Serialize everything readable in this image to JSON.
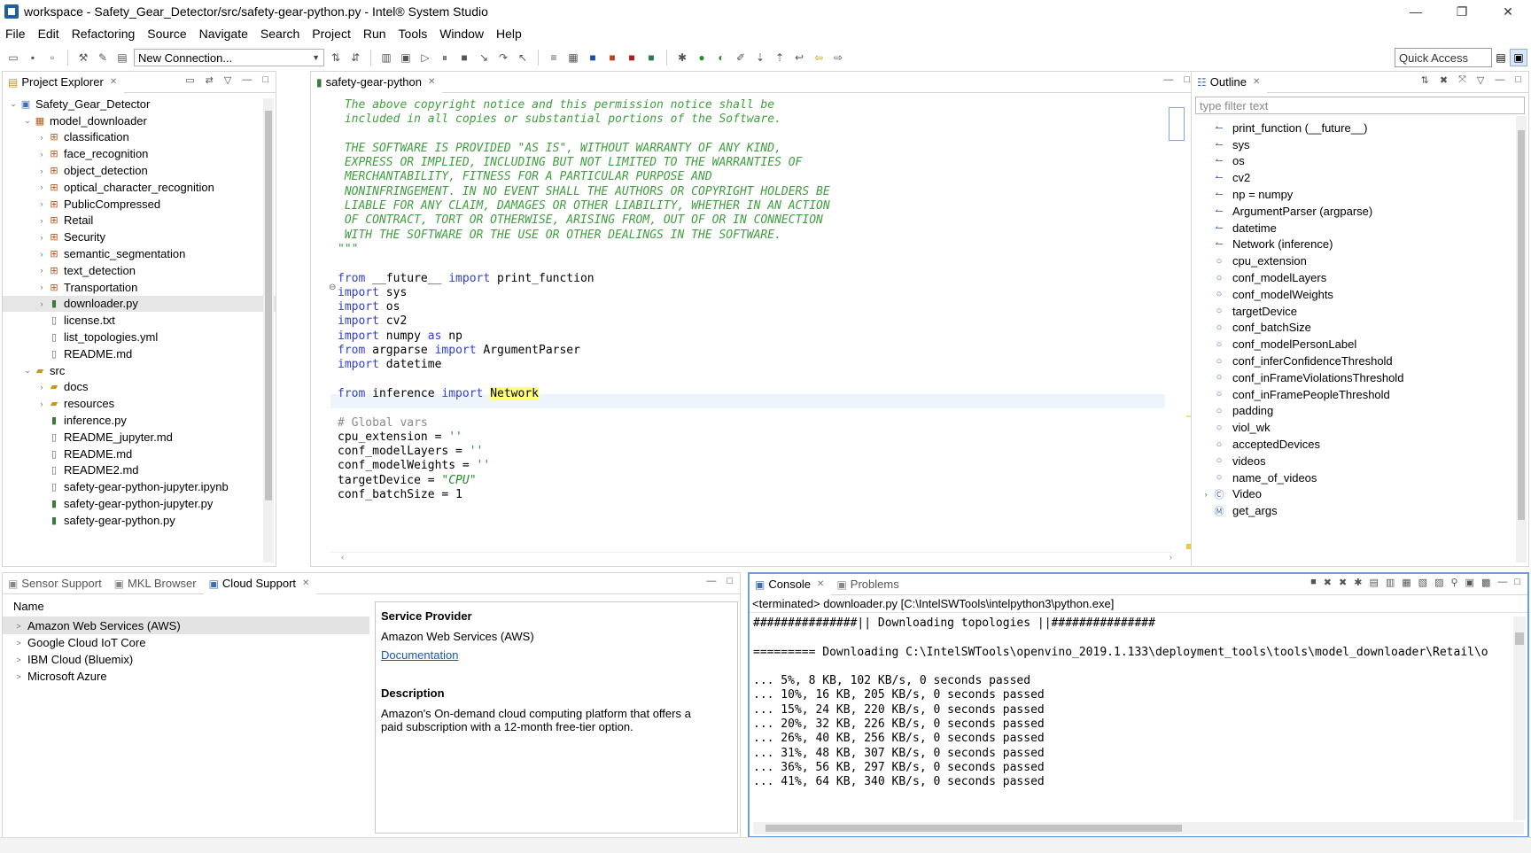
{
  "window": {
    "title": "workspace - Safety_Gear_Detector/src/safety-gear-python.py - Intel® System Studio",
    "minimize": "—",
    "maximize": "❐",
    "close": "✕"
  },
  "menu": [
    "File",
    "Edit",
    "Refactoring",
    "Source",
    "Navigate",
    "Search",
    "Project",
    "Run",
    "Tools",
    "Window",
    "Help"
  ],
  "toolbar": {
    "connection_label": "New Connection...",
    "quick_access": "Quick Access"
  },
  "project_explorer": {
    "tab_label": "Project Explorer",
    "items": [
      {
        "label": "Safety_Gear_Detector",
        "indent": 0,
        "chev": "v",
        "icon": "project-icon"
      },
      {
        "label": "model_downloader",
        "indent": 1,
        "chev": "v",
        "icon": "package-folder-icon"
      },
      {
        "label": "classification",
        "indent": 2,
        "chev": ">",
        "icon": "package-icon"
      },
      {
        "label": "face_recognition",
        "indent": 2,
        "chev": ">",
        "icon": "package-icon"
      },
      {
        "label": "object_detection",
        "indent": 2,
        "chev": ">",
        "icon": "package-icon"
      },
      {
        "label": "optical_character_recognition",
        "indent": 2,
        "chev": ">",
        "icon": "package-icon"
      },
      {
        "label": "PublicCompressed",
        "indent": 2,
        "chev": ">",
        "icon": "package-icon"
      },
      {
        "label": "Retail",
        "indent": 2,
        "chev": ">",
        "icon": "package-icon"
      },
      {
        "label": "Security",
        "indent": 2,
        "chev": ">",
        "icon": "package-icon"
      },
      {
        "label": "semantic_segmentation",
        "indent": 2,
        "chev": ">",
        "icon": "package-icon"
      },
      {
        "label": "text_detection",
        "indent": 2,
        "chev": ">",
        "icon": "package-icon"
      },
      {
        "label": "Transportation",
        "indent": 2,
        "chev": ">",
        "icon": "package-icon"
      },
      {
        "label": "downloader.py",
        "indent": 2,
        "chev": ">",
        "icon": "python-file-icon",
        "selected": true
      },
      {
        "label": "license.txt",
        "indent": 2,
        "chev": "",
        "icon": "text-file-icon"
      },
      {
        "label": "list_topologies.yml",
        "indent": 2,
        "chev": "",
        "icon": "text-file-icon"
      },
      {
        "label": "README.md",
        "indent": 2,
        "chev": "",
        "icon": "text-file-icon"
      },
      {
        "label": "src",
        "indent": 1,
        "chev": "v",
        "icon": "source-folder-icon"
      },
      {
        "label": "docs",
        "indent": 2,
        "chev": ">",
        "icon": "folder-icon"
      },
      {
        "label": "resources",
        "indent": 2,
        "chev": ">",
        "icon": "folder-icon"
      },
      {
        "label": "inference.py",
        "indent": 2,
        "chev": "",
        "icon": "python-file-icon"
      },
      {
        "label": "README_jupyter.md",
        "indent": 2,
        "chev": "",
        "icon": "text-file-icon"
      },
      {
        "label": "README.md",
        "indent": 2,
        "chev": "",
        "icon": "text-file-icon"
      },
      {
        "label": "README2.md",
        "indent": 2,
        "chev": "",
        "icon": "text-file-icon"
      },
      {
        "label": "safety-gear-python-jupyter.ipynb",
        "indent": 2,
        "chev": "",
        "icon": "text-file-icon"
      },
      {
        "label": "safety-gear-python-jupyter.py",
        "indent": 2,
        "chev": "",
        "icon": "python-file-icon"
      },
      {
        "label": "safety-gear-python.py",
        "indent": 2,
        "chev": "",
        "icon": "python-file-icon"
      }
    ]
  },
  "editor": {
    "tab_label": "safety-gear-python",
    "lines": [
      [
        {
          "t": " The above copyright notice and this permission notice shall be",
          "c": "c-cmt"
        }
      ],
      [
        {
          "t": " included in all copies or substantial portions of the Software.",
          "c": "c-cmt"
        }
      ],
      [
        {
          "t": "",
          "c": ""
        }
      ],
      [
        {
          "t": " THE SOFTWARE IS PROVIDED \"AS IS\", WITHOUT WARRANTY OF ANY KIND,",
          "c": "c-cmt"
        }
      ],
      [
        {
          "t": " EXPRESS OR IMPLIED, INCLUDING BUT NOT LIMITED TO THE WARRANTIES OF",
          "c": "c-cmt"
        }
      ],
      [
        {
          "t": " MERCHANTABILITY, FITNESS FOR A PARTICULAR PURPOSE AND",
          "c": "c-cmt"
        }
      ],
      [
        {
          "t": " NONINFRINGEMENT. IN NO EVENT SHALL THE AUTHORS OR COPYRIGHT HOLDERS BE",
          "c": "c-cmt"
        }
      ],
      [
        {
          "t": " LIABLE FOR ANY CLAIM, DAMAGES OR OTHER LIABILITY, WHETHER IN AN ACTION",
          "c": "c-cmt"
        }
      ],
      [
        {
          "t": " OF CONTRACT, TORT OR OTHERWISE, ARISING FROM, OUT OF OR IN CONNECTION",
          "c": "c-cmt"
        }
      ],
      [
        {
          "t": " WITH THE SOFTWARE OR THE USE OR OTHER DEALINGS IN THE SOFTWARE.",
          "c": "c-cmt"
        }
      ],
      [
        {
          "t": "\"\"\"",
          "c": "c-cmt"
        }
      ],
      [
        {
          "t": "",
          "c": ""
        }
      ],
      [
        {
          "t": "from",
          "c": "c-kw"
        },
        {
          "t": " __future__ ",
          "c": ""
        },
        {
          "t": "import",
          "c": "c-kw"
        },
        {
          "t": " print_function",
          "c": ""
        }
      ],
      [
        {
          "t": "import",
          "c": "c-kw"
        },
        {
          "t": " sys",
          "c": ""
        }
      ],
      [
        {
          "t": "import",
          "c": "c-kw"
        },
        {
          "t": " os",
          "c": ""
        }
      ],
      [
        {
          "t": "import",
          "c": "c-kw"
        },
        {
          "t": " cv2",
          "c": ""
        }
      ],
      [
        {
          "t": "import",
          "c": "c-kw"
        },
        {
          "t": " numpy ",
          "c": ""
        },
        {
          "t": "as",
          "c": "c-kw"
        },
        {
          "t": " np",
          "c": ""
        }
      ],
      [
        {
          "t": "from",
          "c": "c-kw"
        },
        {
          "t": " argparse ",
          "c": ""
        },
        {
          "t": "import",
          "c": "c-kw"
        },
        {
          "t": " ArgumentParser",
          "c": ""
        }
      ],
      [
        {
          "t": "import",
          "c": "c-kw"
        },
        {
          "t": " datetime",
          "c": ""
        }
      ],
      [
        {
          "t": "",
          "c": ""
        }
      ],
      [
        {
          "t": "from",
          "c": "c-kw"
        },
        {
          "t": " inference ",
          "c": ""
        },
        {
          "t": "import",
          "c": "c-kw"
        },
        {
          "t": " ",
          "c": ""
        },
        {
          "t": "Network",
          "c": "c-hl"
        }
      ],
      [
        {
          "t": "",
          "c": ""
        }
      ],
      [
        {
          "t": "# Global vars",
          "c": "c-gray"
        }
      ],
      [
        {
          "t": "cpu_extension = ",
          "c": ""
        },
        {
          "t": "''",
          "c": "c-str"
        }
      ],
      [
        {
          "t": "conf_modelLayers = ",
          "c": ""
        },
        {
          "t": "''",
          "c": "c-str"
        }
      ],
      [
        {
          "t": "conf_modelWeights = ",
          "c": ""
        },
        {
          "t": "''",
          "c": "c-str"
        }
      ],
      [
        {
          "t": "targetDevice = ",
          "c": ""
        },
        {
          "t": "\"CPU\"",
          "c": "c-str"
        }
      ],
      [
        {
          "t": "conf_batchSize = 1",
          "c": ""
        }
      ]
    ]
  },
  "outline": {
    "tab_label": "Outline",
    "filter_placeholder": "type filter text",
    "items": [
      {
        "label": "print_function (__future__)",
        "icon": "import-icon"
      },
      {
        "label": "sys",
        "icon": "import-icon"
      },
      {
        "label": "os",
        "icon": "import-icon"
      },
      {
        "label": "cv2",
        "icon": "import-icon"
      },
      {
        "label": "np = numpy",
        "icon": "import-icon"
      },
      {
        "label": "ArgumentParser (argparse)",
        "icon": "import-icon"
      },
      {
        "label": "datetime",
        "icon": "import-icon"
      },
      {
        "label": "Network (inference)",
        "icon": "import-icon"
      },
      {
        "label": "cpu_extension",
        "icon": "variable-icon"
      },
      {
        "label": "conf_modelLayers",
        "icon": "variable-icon"
      },
      {
        "label": "conf_modelWeights",
        "icon": "variable-icon"
      },
      {
        "label": "targetDevice",
        "icon": "variable-icon"
      },
      {
        "label": "conf_batchSize",
        "icon": "variable-icon"
      },
      {
        "label": "conf_modelPersonLabel",
        "icon": "variable-icon"
      },
      {
        "label": "conf_inferConfidenceThreshold",
        "icon": "variable-icon"
      },
      {
        "label": "conf_inFrameViolationsThreshold",
        "icon": "variable-icon"
      },
      {
        "label": "conf_inFramePeopleThreshold",
        "icon": "variable-icon"
      },
      {
        "label": "padding",
        "icon": "variable-icon"
      },
      {
        "label": "viol_wk",
        "icon": "variable-icon"
      },
      {
        "label": "acceptedDevices",
        "icon": "variable-icon"
      },
      {
        "label": "videos",
        "icon": "variable-icon"
      },
      {
        "label": "name_of_videos",
        "icon": "variable-icon"
      },
      {
        "label": "Video",
        "icon": "class-icon",
        "chev": ">"
      },
      {
        "label": "get_args",
        "icon": "function-icon"
      }
    ]
  },
  "bottom_left": {
    "tabs": [
      "Sensor Support",
      "MKL Browser",
      "Cloud Support"
    ],
    "active_tab": 2,
    "column_name": "Name",
    "providers": [
      "Amazon Web Services (AWS)",
      "Google Cloud IoT Core",
      "IBM Cloud (Bluemix)",
      "Microsoft Azure"
    ],
    "detail": {
      "provider_heading": "Service Provider",
      "provider_value": "Amazon Web Services (AWS)",
      "doc_link": "Documentation",
      "desc_heading": "Description",
      "desc_line1": "Amazon's On-demand cloud computing platform that offers a",
      "desc_line2": "paid subscription with a 12-month free-tier option."
    }
  },
  "console": {
    "tabs": [
      "Console",
      "Problems"
    ],
    "path": "<terminated> downloader.py [C:\\IntelSWTools\\intelpython3\\python.exe]",
    "lines": [
      "###############|| Downloading topologies ||###############",
      "",
      "========= Downloading C:\\IntelSWTools\\openvino_2019.1.133\\deployment_tools\\tools\\model_downloader\\Retail\\o",
      "",
      "... 5%, 8 KB, 102 KB/s, 0 seconds passed",
      "... 10%, 16 KB, 205 KB/s, 0 seconds passed",
      "... 15%, 24 KB, 220 KB/s, 0 seconds passed",
      "... 20%, 32 KB, 226 KB/s, 0 seconds passed",
      "... 26%, 40 KB, 256 KB/s, 0 seconds passed",
      "... 31%, 48 KB, 307 KB/s, 0 seconds passed",
      "... 36%, 56 KB, 297 KB/s, 0 seconds passed",
      "... 41%, 64 KB, 340 KB/s, 0 seconds passed"
    ]
  }
}
